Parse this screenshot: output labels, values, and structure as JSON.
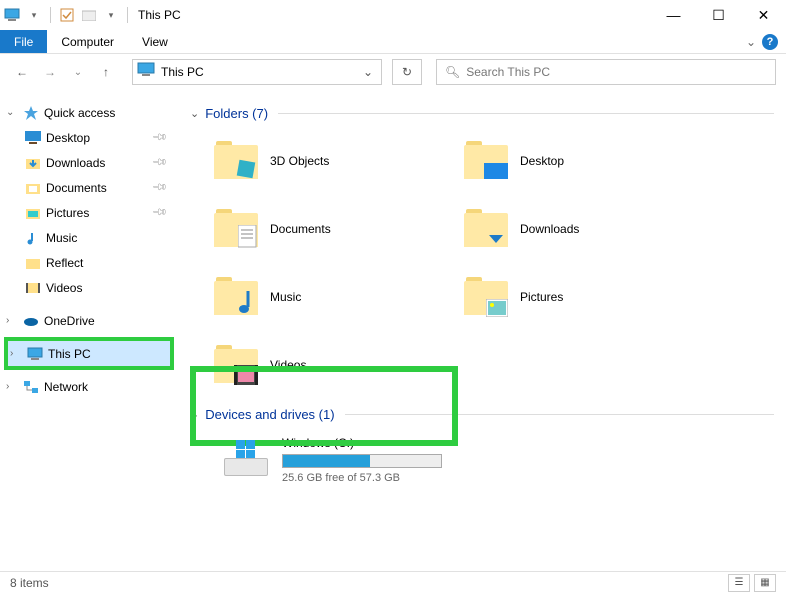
{
  "window": {
    "title": "This PC",
    "minimize": "—",
    "maximize": "☐",
    "close": "✕"
  },
  "ribbon": {
    "tabs": {
      "file": "File",
      "computer": "Computer",
      "view": "View"
    },
    "expand": "⌄",
    "help": "?"
  },
  "nav": {
    "address": "This PC",
    "search_placeholder": "Search This PC"
  },
  "sidebar": {
    "quick_access": "Quick access",
    "items": [
      {
        "label": "Desktop",
        "icon": "desktop"
      },
      {
        "label": "Downloads",
        "icon": "downloads"
      },
      {
        "label": "Documents",
        "icon": "documents"
      },
      {
        "label": "Pictures",
        "icon": "pictures"
      },
      {
        "label": "Music",
        "icon": "music"
      },
      {
        "label": "Reflect",
        "icon": "folder"
      },
      {
        "label": "Videos",
        "icon": "videos"
      }
    ],
    "onedrive": "OneDrive",
    "thispc": "This PC",
    "network": "Network"
  },
  "content": {
    "folders_header": "Folders (7)",
    "folders": [
      {
        "label": "3D Objects"
      },
      {
        "label": "Desktop"
      },
      {
        "label": "Documents"
      },
      {
        "label": "Downloads"
      },
      {
        "label": "Music"
      },
      {
        "label": "Pictures"
      },
      {
        "label": "Videos"
      }
    ],
    "devices_header": "Devices and drives (1)",
    "drive": {
      "name": "Windows (C:)",
      "stats": "25.6 GB free of 57.3 GB",
      "fill_percent": 55
    }
  },
  "statusbar": {
    "count": "8 items"
  }
}
